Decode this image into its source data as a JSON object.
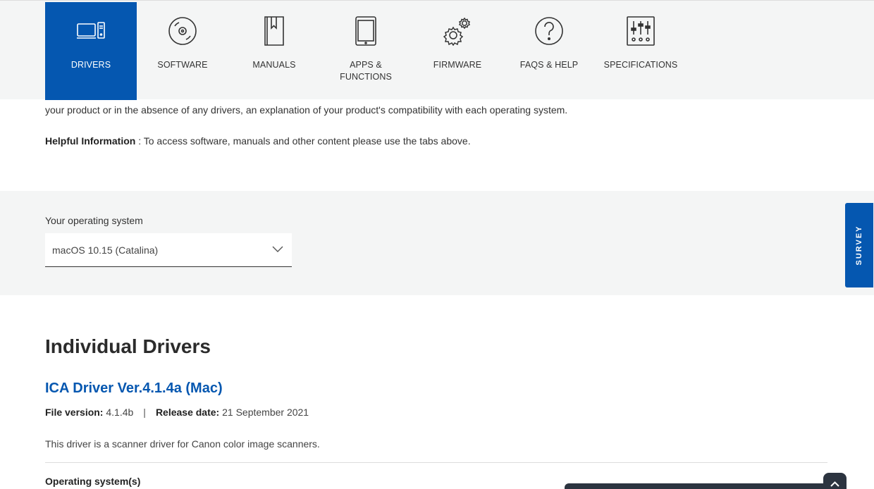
{
  "tabs": [
    {
      "label": "DRIVERS",
      "icon": "computer-icon",
      "active": true
    },
    {
      "label": "SOFTWARE",
      "icon": "disc-icon",
      "active": false
    },
    {
      "label": "MANUALS",
      "icon": "book-icon",
      "active": false
    },
    {
      "label": "APPS &\nFUNCTIONS",
      "icon": "tablet-icon",
      "active": false
    },
    {
      "label": "FIRMWARE",
      "icon": "gears-icon",
      "active": false
    },
    {
      "label": "FAQS & HELP",
      "icon": "question-icon",
      "active": false
    },
    {
      "label": "SPECIFICATIONS",
      "icon": "sliders-icon",
      "active": false
    }
  ],
  "intro": {
    "text": "your product or in the absence of any drivers, an explanation of your product's compatibility with each operating system.",
    "helpful_label": "Helpful Information",
    "helpful_text": " : To access software, manuals and other content please use the tabs above."
  },
  "os": {
    "label": "Your operating system",
    "selected": "macOS 10.15 (Catalina)"
  },
  "survey": {
    "label": "SURVEY"
  },
  "drivers": {
    "section_title": "Individual Drivers",
    "item": {
      "title": "ICA Driver Ver.4.1.4a (Mac)",
      "file_version_label": "File version:",
      "file_version": " 4.1.4b",
      "separator": "|",
      "release_label": "Release date:",
      "release_date": " 21 September 2021",
      "description": "This driver is a scanner driver for Canon color image scanners.",
      "os_heading": "Operating system(s)"
    }
  },
  "colors": {
    "accent": "#0557b0",
    "band": "#f4f5f5",
    "chat": "#2c3440"
  }
}
